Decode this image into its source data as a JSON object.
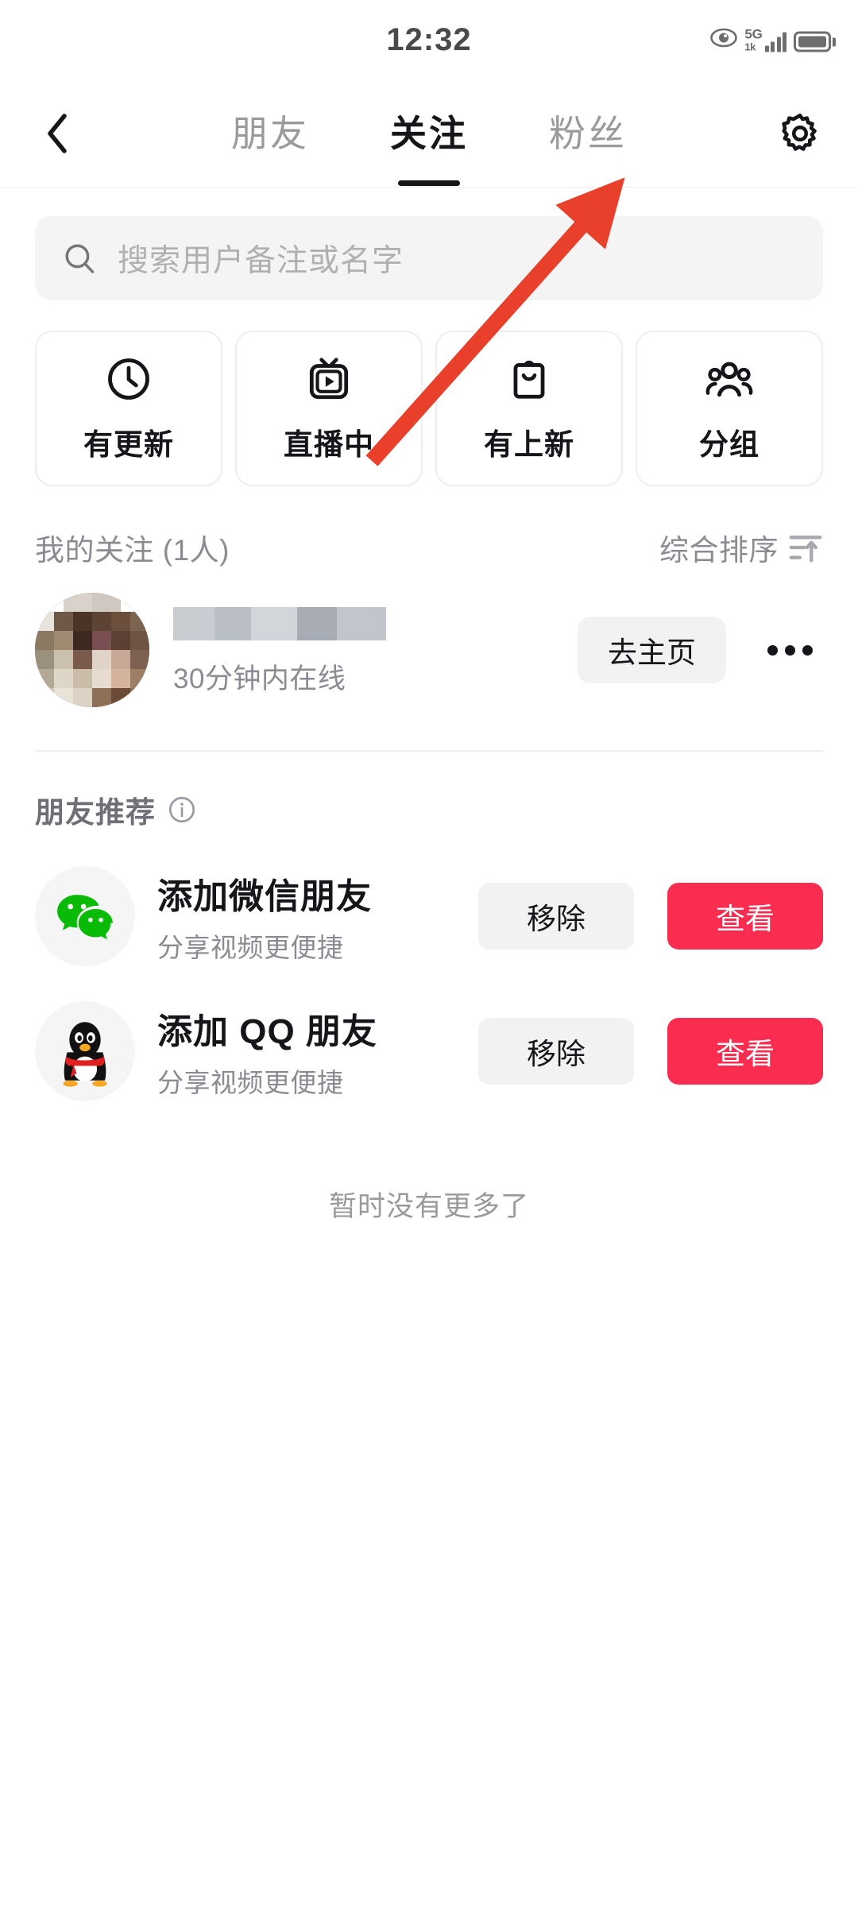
{
  "status_bar": {
    "time": "12:32",
    "eye_icon": "eye-icon",
    "network_type": "5G",
    "network_sub": "1k",
    "signal_bars": 4,
    "battery_icon": "battery-icon"
  },
  "nav": {
    "back_icon": "chevron-left-icon",
    "settings_icon": "gear-icon",
    "tabs": [
      {
        "label": "朋友",
        "active": false
      },
      {
        "label": "关注",
        "active": true
      },
      {
        "label": "粉丝",
        "active": false
      }
    ]
  },
  "search": {
    "icon": "search-icon",
    "placeholder": "搜索用户备注或名字",
    "value": ""
  },
  "quick_cards": [
    {
      "label": "有更新",
      "icon": "clock-icon"
    },
    {
      "label": "直播中",
      "icon": "live-tv-icon"
    },
    {
      "label": "有上新",
      "icon": "shopping-bag-icon"
    },
    {
      "label": "分组",
      "icon": "group-people-icon"
    }
  ],
  "following_section": {
    "title": "我的关注 (1人)",
    "sort_label": "综合排序",
    "sort_icon": "filter-sort-icon",
    "users": [
      {
        "avatar": "user-avatar-pixelated",
        "name": "",
        "name_redacted": true,
        "status": "30分钟内在线",
        "home_button": "去主页",
        "more_icon": "more-dots-icon"
      }
    ]
  },
  "recommend_section": {
    "title": "朋友推荐",
    "info_icon": "info-circle-icon",
    "items": [
      {
        "logo": "wechat-icon",
        "name": "添加微信朋友",
        "subtitle": "分享视频更便捷",
        "remove_label": "移除",
        "view_label": "查看"
      },
      {
        "logo": "qq-penguin-icon",
        "name": "添加 QQ 朋友",
        "subtitle": "分享视频更便捷",
        "remove_label": "移除",
        "view_label": "查看"
      }
    ]
  },
  "footer": {
    "end_text": "暂时没有更多了"
  },
  "annotation": {
    "arrow_icon": "red-arrow-annotation",
    "color": "#E8402A",
    "points_to": "粉丝"
  },
  "colors": {
    "accent_pink": "#FA2C50",
    "text_primary": "#15161a",
    "text_secondary": "#8b8b93",
    "text_muted": "#b0b0b0",
    "field_bg": "#f4f4f4",
    "button_bg": "#f2f2f2",
    "border": "#eeeeee",
    "annotation_red": "#E8402A"
  }
}
